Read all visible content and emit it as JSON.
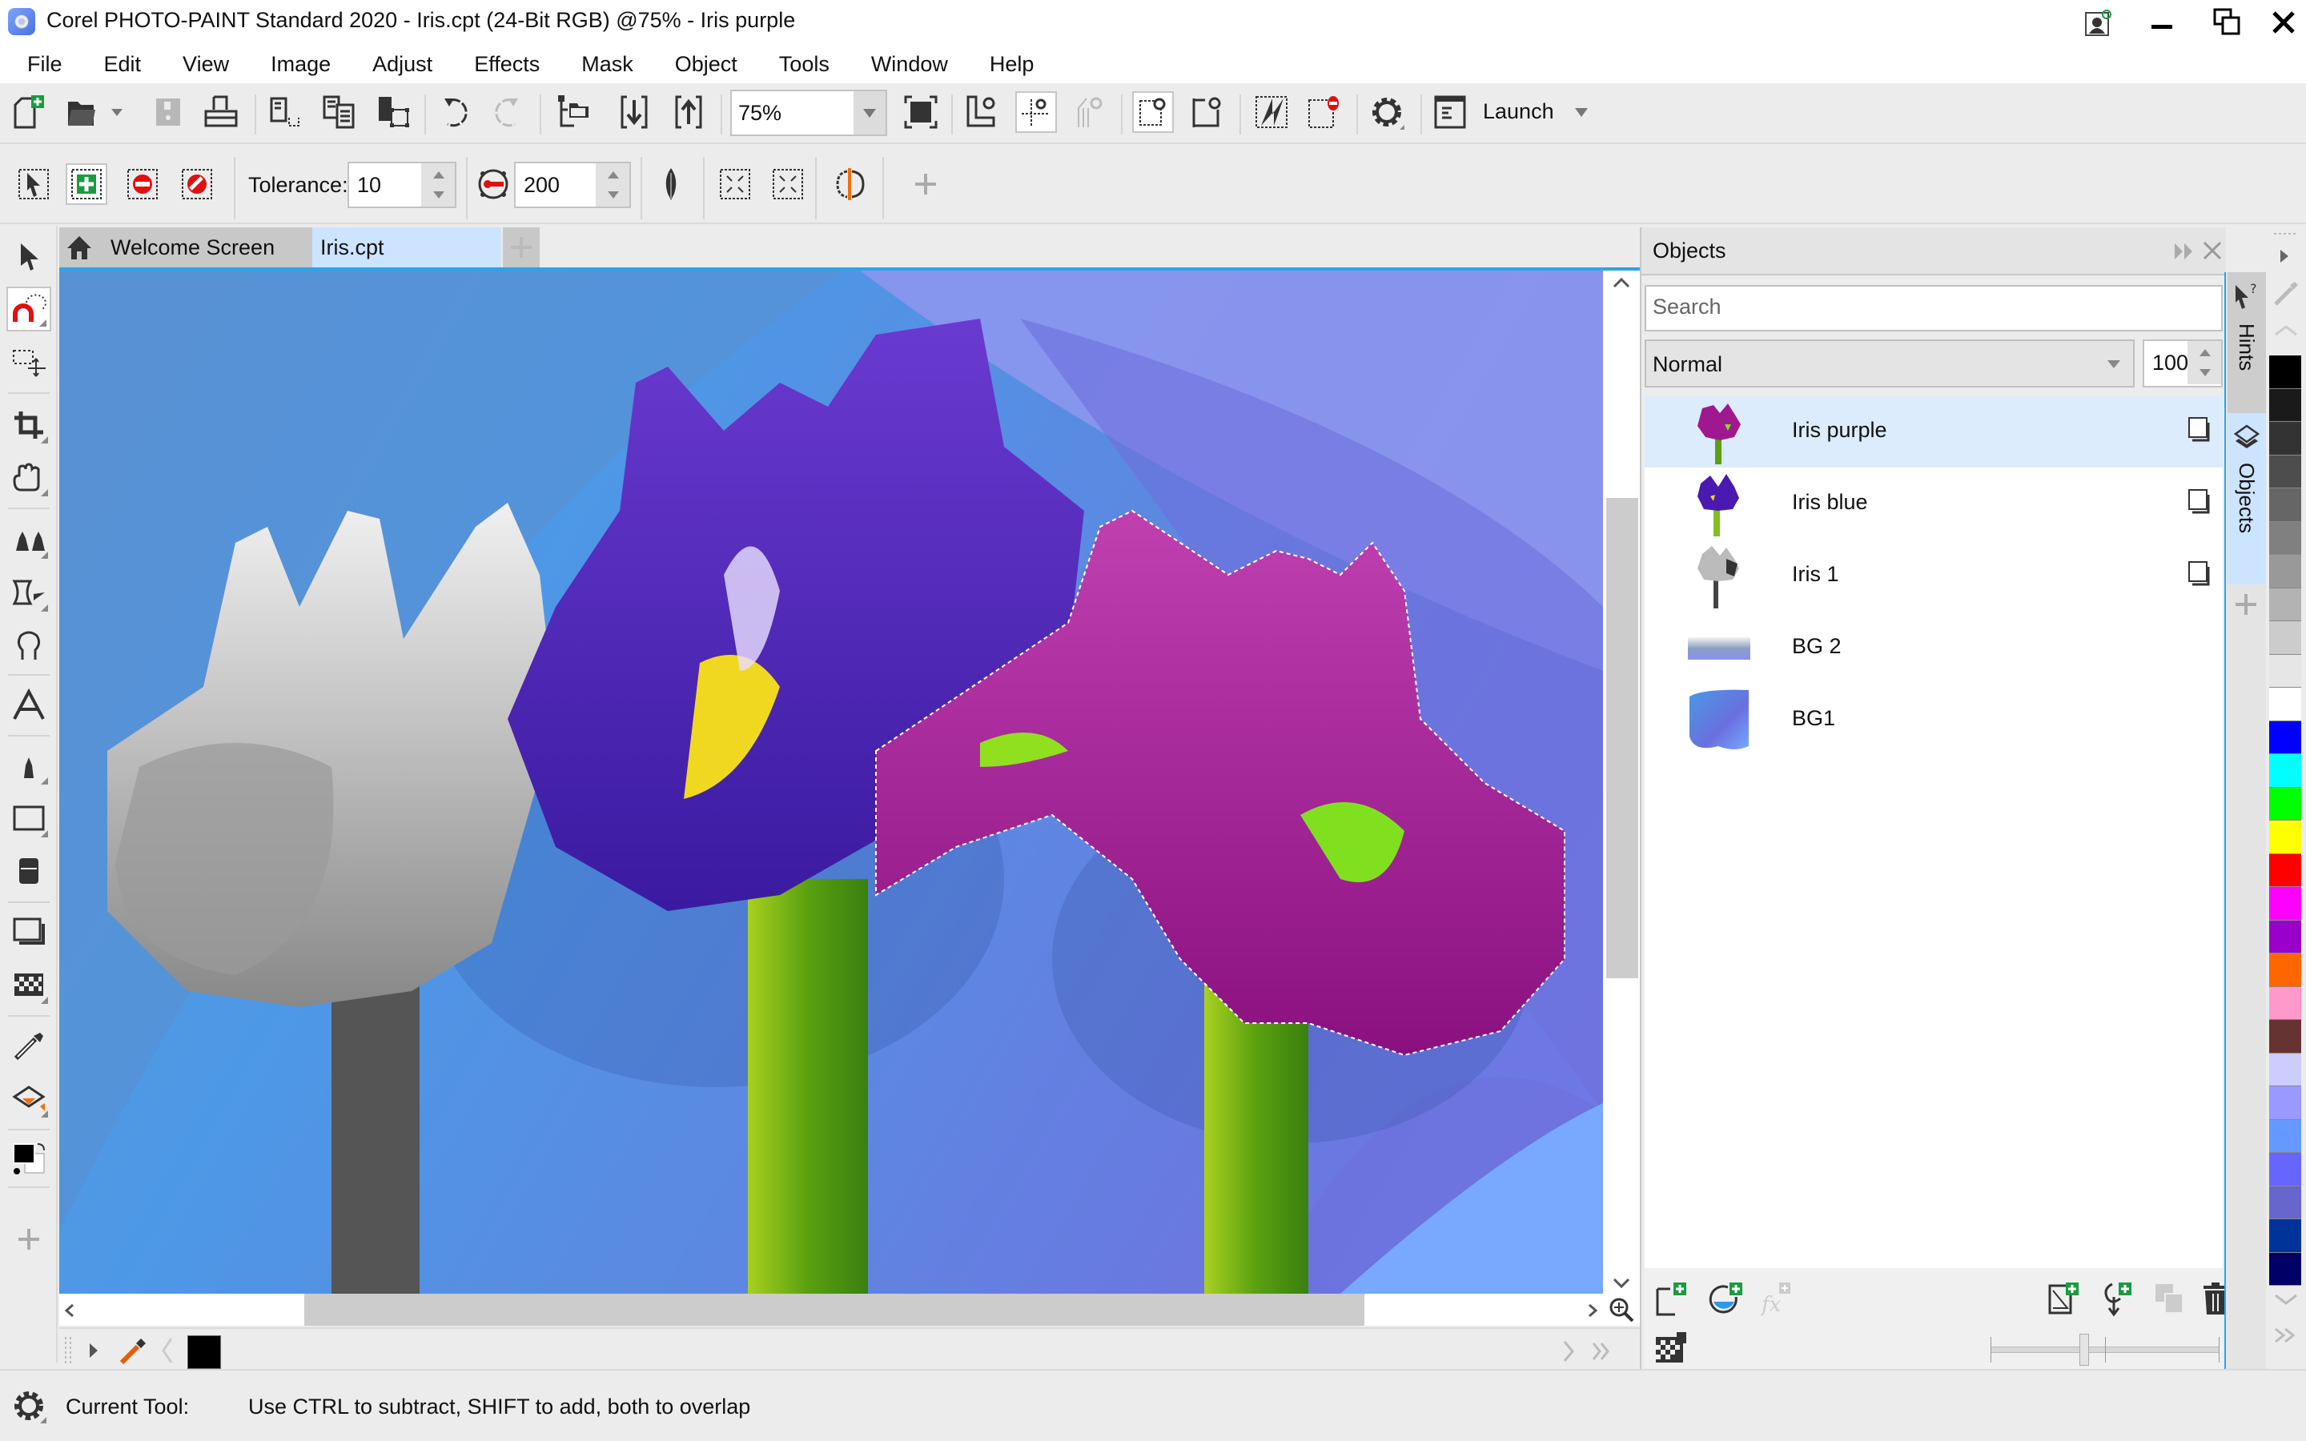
{
  "window": {
    "title": "Corel PHOTO-PAINT Standard 2020 - Iris.cpt (24-Bit RGB) @75% - Iris purple",
    "controls": [
      "account-icon",
      "minimize",
      "restore",
      "close"
    ]
  },
  "menu": {
    "items": [
      {
        "label": "File",
        "mnemonic": "F"
      },
      {
        "label": "Edit",
        "mnemonic": "E"
      },
      {
        "label": "View",
        "mnemonic": "V"
      },
      {
        "label": "Image",
        "mnemonic": "I"
      },
      {
        "label": "Adjust",
        "mnemonic": "A"
      },
      {
        "label": "Effects",
        "mnemonic": "c"
      },
      {
        "label": "Mask",
        "mnemonic": "k"
      },
      {
        "label": "Object",
        "mnemonic": "O"
      },
      {
        "label": "Tools",
        "mnemonic": "T"
      },
      {
        "label": "Window",
        "mnemonic": "W"
      },
      {
        "label": "Help",
        "mnemonic": "H"
      }
    ]
  },
  "standard_toolbar": {
    "buttons": [
      "new",
      "open",
      "save",
      "print",
      "cut",
      "copy",
      "paste",
      "undo",
      "redo",
      "import-objects",
      "import",
      "export"
    ],
    "zoom_level": "75%",
    "more_buttons": [
      "zoom-to-fit",
      "rulers",
      "guidelines",
      "snap",
      "mask-marquee",
      "mask-overlay",
      "restore-to-checkpoint",
      "remove-mask",
      "options"
    ],
    "launch_label": "Launch"
  },
  "property_bar": {
    "mode_buttons": [
      "normal-mode",
      "additive-mode",
      "subtractive-mode",
      "xor-mode"
    ],
    "active_mode": "additive-mode",
    "tolerance_label": "Tolerance:",
    "tolerance_value": "10",
    "radius_value": "200",
    "extra_buttons": [
      "feather",
      "expand-mask",
      "shrink-mask",
      "anti-alias"
    ]
  },
  "toolbox": {
    "tools": [
      "pick",
      "magnetic-mask",
      "mask-transform",
      "crop",
      "pan",
      "effect-tools",
      "touch-up",
      "liquid",
      "text",
      "paint",
      "rectangle",
      "eraser",
      "clone-shadow",
      "transparency",
      "eyedropper",
      "fill",
      "color-swatches",
      "add-tool"
    ],
    "active_tool": "magnetic-mask"
  },
  "document_tabs": [
    {
      "label": "Welcome Screen",
      "icon": "home-icon",
      "active": false
    },
    {
      "label": "Iris.cpt",
      "active": true
    }
  ],
  "canvas": {
    "selection_on": "Iris purple"
  },
  "docbar": {
    "fill_color": "#000000"
  },
  "status": {
    "label": "Current Tool:",
    "message": "Use CTRL to subtract, SHIFT to add, both to overlap"
  },
  "objects_panel": {
    "title": "Objects",
    "search_placeholder": "Search",
    "blend_mode": "Normal",
    "opacity": "100",
    "objects": [
      {
        "name": "Iris purple",
        "selected": true,
        "has_mask_icon": true,
        "thumb": "purple"
      },
      {
        "name": "Iris blue",
        "selected": false,
        "has_mask_icon": true,
        "thumb": "blue"
      },
      {
        "name": "Iris 1",
        "selected": false,
        "has_mask_icon": true,
        "thumb": "gray"
      },
      {
        "name": "BG 2",
        "selected": false,
        "has_mask_icon": false,
        "thumb": "bg2"
      },
      {
        "name": "BG1",
        "selected": false,
        "has_mask_icon": false,
        "thumb": "bg1"
      }
    ],
    "opacity_slider": 0.41
  },
  "side_tabs": [
    {
      "label": "Hints",
      "active": false
    },
    {
      "label": "Objects",
      "active": true
    }
  ],
  "palette": {
    "colors": [
      "#000000",
      "#1a1a1a",
      "#333333",
      "#4d4d4d",
      "#666666",
      "#808080",
      "#999999",
      "#b3b3b3",
      "#cccccc",
      "#e6e6e6",
      "#ffffff",
      "#0000ff",
      "#00ffff",
      "#00ff00",
      "#ffff00",
      "#ff0000",
      "#ff00ff",
      "#9900cc",
      "#ff6600",
      "#ff99cc",
      "#663333",
      "#ccccff",
      "#9999ff",
      "#6699ff",
      "#6666ff",
      "#6666cc",
      "#003399",
      "#000066"
    ]
  }
}
